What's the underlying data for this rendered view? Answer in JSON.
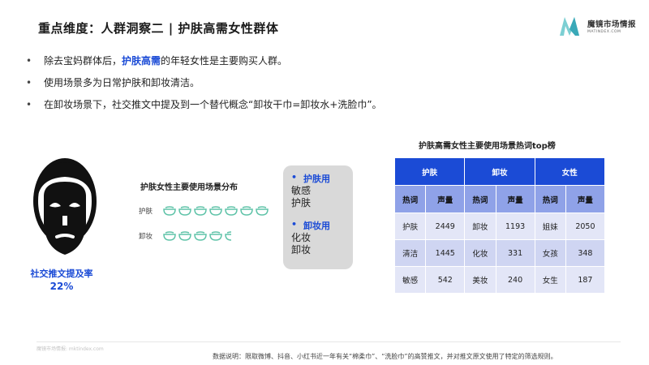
{
  "header": {
    "title": "重点维度：人群洞察二 | 护肤高需女性群体",
    "brand_name": "魔镜市场情报",
    "brand_url": "MATINDEX.COM"
  },
  "bullets": [
    {
      "pre": "除去宝妈群体后，",
      "highlight": "护肤高需",
      "post": "的年轻女性是主要购买人群。"
    },
    {
      "pre": "使用场景多为日常护肤和卸妆清洁。",
      "highlight": "",
      "post": ""
    },
    {
      "pre": "在卸妆场景下，社交推文中提及到一个替代概念“卸妆干巾=卸妆水+洗脸巾”。",
      "highlight": "",
      "post": ""
    }
  ],
  "persona": {
    "rate_label": "社交推文提及率",
    "rate_value": "22%",
    "rate": 0.22
  },
  "distribution": {
    "title": "护肤女性主要使用场景分布",
    "rows": [
      {
        "label": "护肤",
        "icons": 7
      },
      {
        "label": "卸妆",
        "icons": 4.5
      }
    ]
  },
  "scenes": {
    "skincare_title": "护肤用",
    "skincare_items": [
      "敏感",
      "护肤"
    ],
    "makeup_title": "卸妆用",
    "makeup_items": [
      "化妆",
      "卸妆"
    ]
  },
  "hot_table": {
    "title": "护肤高需女性主要使用场景热词top榜",
    "groups": [
      "护肤",
      "卸妆",
      "女性"
    ],
    "subheaders": [
      "热词",
      "声量",
      "热词",
      "声量",
      "热词",
      "声量"
    ],
    "rows": [
      [
        "护肤",
        "2449",
        "卸妆",
        "1193",
        "姐妹",
        "2050"
      ],
      [
        "清洁",
        "1445",
        "化妆",
        "331",
        "女孩",
        "348"
      ],
      [
        "敏感",
        "542",
        "美妆",
        "240",
        "女生",
        "187"
      ]
    ]
  },
  "footer": {
    "source": "魔镜市场情报: mktindex.com",
    "note": "数据说明：限取微博、抖音、小红书近一年有关“棉柔巾”、“洗脸巾”的高赞推文，并对推文原文使用了特定的筛选规则。"
  },
  "colors": {
    "accent": "#1b4bd6",
    "table_header": "#1b4bd6",
    "table_sub": "#8fa2e8",
    "bowl": "#5fc3a8"
  }
}
